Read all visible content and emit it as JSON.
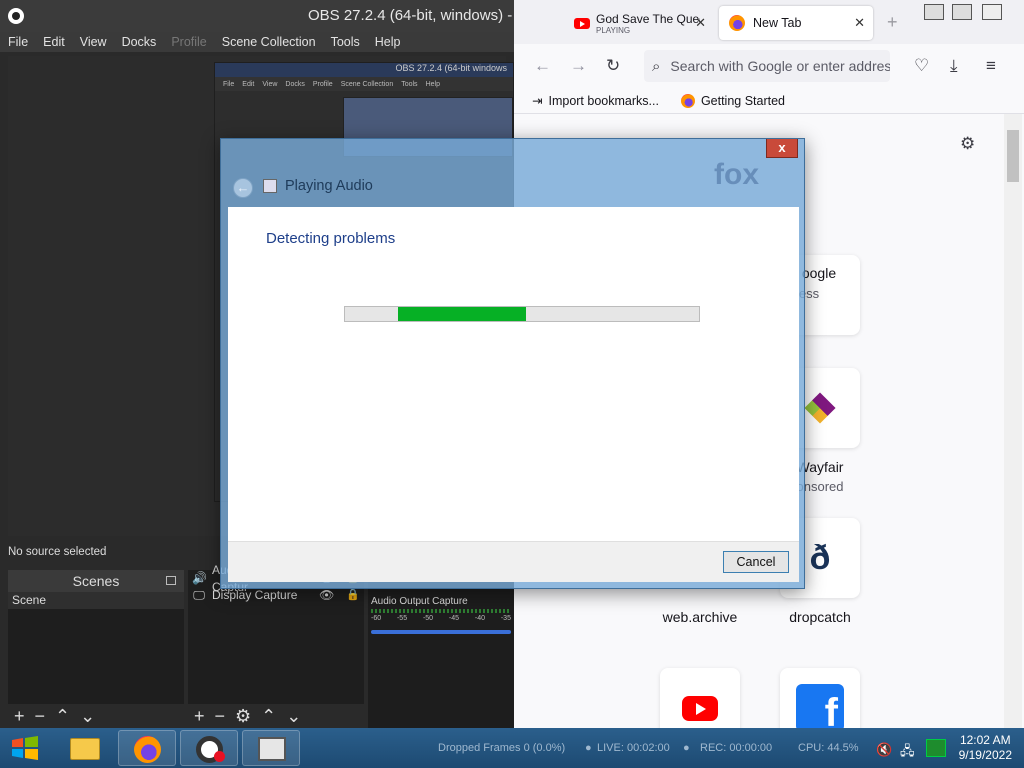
{
  "obs": {
    "title": "OBS 27.2.4 (64-bit, windows) -",
    "menu": [
      "File",
      "Edit",
      "View",
      "Docks",
      "Profile",
      "Scene Collection",
      "Tools",
      "Help"
    ],
    "preview_title": "OBS 27.2.4 (64-bit windows",
    "preview_menu": [
      "File",
      "Edit",
      "View",
      "Docks",
      "Profile",
      "Scene Collection",
      "Tools",
      "Help"
    ],
    "status": "No source selected",
    "scenes": {
      "header": "Scenes",
      "items": [
        "Scene"
      ]
    },
    "sources": {
      "items": [
        {
          "label": "Audio Output Captur",
          "icon": "speaker-icon"
        },
        {
          "label": "Display Capture",
          "icon": "monitor-icon"
        }
      ]
    },
    "mixer": {
      "label": "Audio Output Capture",
      "ticks": [
        "-60",
        "-55",
        "-50",
        "-45",
        "-40",
        "-35"
      ]
    }
  },
  "firefox": {
    "tabs": [
      {
        "title": "God Save The Quee",
        "subtitle": "PLAYING",
        "icon": "youtube-icon"
      },
      {
        "title": "New Tab",
        "icon": "firefox-icon"
      }
    ],
    "url_placeholder": "Search with Google or enter address",
    "bookmarks": [
      "Import bookmarks...",
      "Getting Started"
    ],
    "brand": "fox",
    "tiles": [
      {
        "label": "oogle",
        "sublabel": "ess",
        "icon": "google-icon"
      },
      {
        "label": "Wayfair",
        "sublabel": "onsored",
        "icon": "wayfair-icon"
      },
      {
        "label": "web.archive",
        "icon": "webarchive-icon"
      },
      {
        "label": "dropcatch",
        "icon": "dropcatch-icon"
      },
      {
        "icon": "youtube-icon"
      },
      {
        "icon": "facebook-icon"
      }
    ]
  },
  "dialog": {
    "title": "Playing Audio",
    "heading": "Detecting problems",
    "cancel_label": "Cancel",
    "close_glyph": "x",
    "progress": {
      "start": 0.15,
      "end": 0.51,
      "color": "#06b025"
    }
  },
  "taskbar": {
    "dropped_frames": "Dropped Frames 0 (0.0%)",
    "live": "LIVE: 00:02:00",
    "rec": "REC: 00:00:00",
    "cpu": "CPU: 44.5%",
    "time": "12:02 AM",
    "date": "9/19/2022",
    "apps": [
      "file-explorer-icon",
      "firefox-icon",
      "obs-icon",
      "troubleshooter-icon"
    ]
  }
}
